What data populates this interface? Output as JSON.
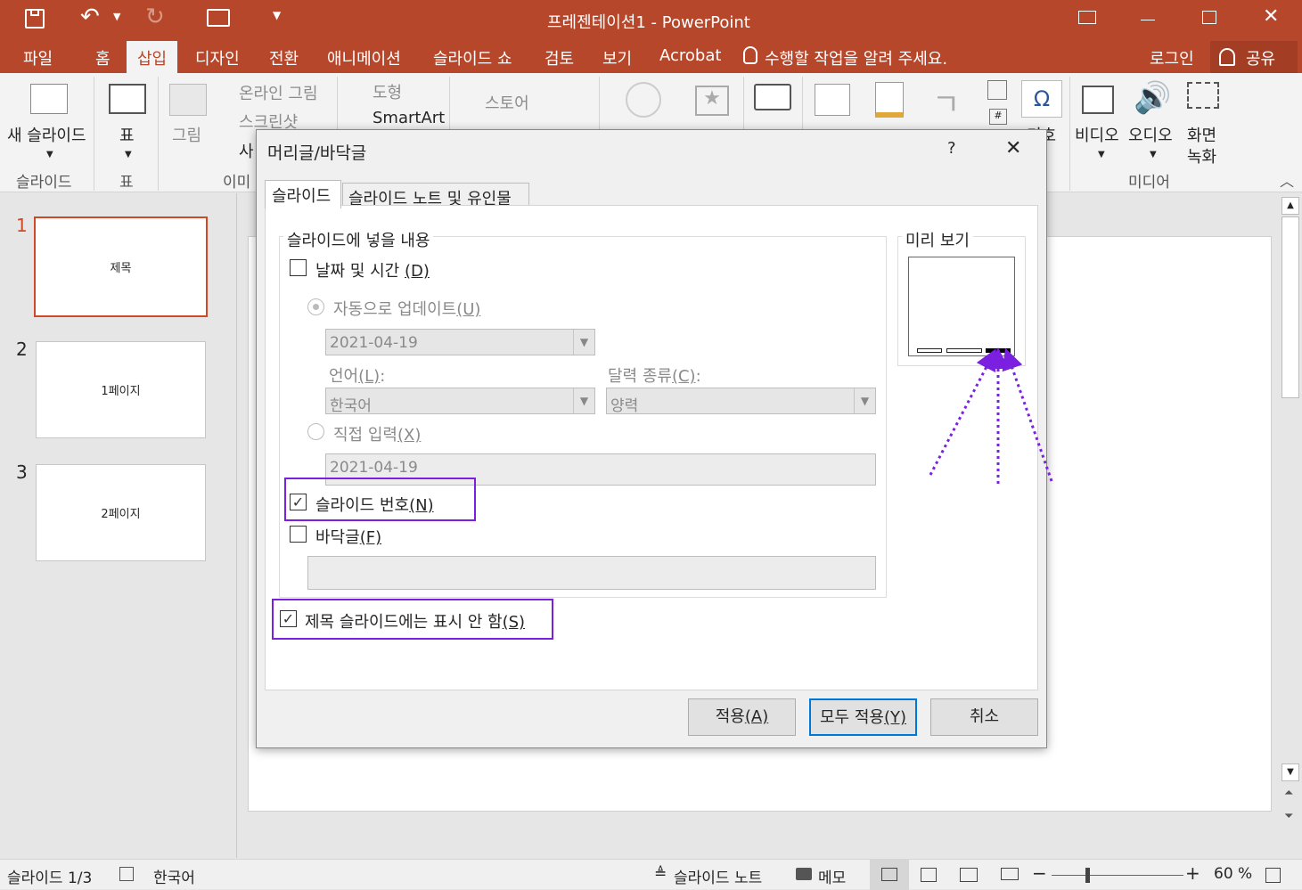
{
  "window": {
    "title": "프레젠테이션1 - PowerPoint"
  },
  "menu": {
    "tabs": [
      "파일",
      "홈",
      "삽입",
      "디자인",
      "전환",
      "애니메이션",
      "슬라이드 쇼",
      "검토",
      "보기",
      "Acrobat"
    ],
    "active_tab": "삽입",
    "tell_me": "수행할 작업을 알려 주세요.",
    "login": "로그인",
    "share": "공유"
  },
  "ribbon": {
    "new_slide": "새 슬라이드",
    "table": "표",
    "picture": "그림",
    "online_picture": "온라인 그림",
    "screenshot": "스크린샷",
    "photo_album_partial": "사",
    "shapes": "도형",
    "smartart": "SmartArt",
    "store": "스토어",
    "symbol_partial": "기호",
    "video": "비디오",
    "audio": "오디오",
    "screen_record_1": "화면",
    "screen_record_2": "녹화",
    "groups": {
      "slides": "슬라이드",
      "tables": "표",
      "images_partial": "이미",
      "media": "미디어"
    }
  },
  "slides": [
    {
      "num": "1",
      "text": "제목"
    },
    {
      "num": "2",
      "text": "1페이지"
    },
    {
      "num": "3",
      "text": "2페이지"
    }
  ],
  "dialog": {
    "title": "머리글/바닥글",
    "help": "?",
    "tabs": [
      "슬라이드",
      "슬라이드 노트 및 유인물"
    ],
    "group_label": "슬라이드에 넣을 내용",
    "date_time": {
      "label": "날짜 및 시간",
      "key": "(D)",
      "checked": false
    },
    "auto_update": {
      "label": "자동으로 업데이트",
      "key": "(U)"
    },
    "auto_date_value": "2021-04-19",
    "language": {
      "label": "언어",
      "key": "(L)",
      "suffix": ":",
      "value": "한국어"
    },
    "calendar": {
      "label": "달력 종류",
      "key": "(C)",
      "suffix": ":",
      "value": "양력"
    },
    "fixed": {
      "label": "직접 입력",
      "key": "(X)"
    },
    "fixed_value": "2021-04-19",
    "slide_number": {
      "label": "슬라이드 번호",
      "key": "(N)",
      "checked": true
    },
    "footer": {
      "label": "바닥글",
      "key": "(F)",
      "checked": false
    },
    "footer_value": "",
    "dont_show_title": {
      "label": "제목 슬라이드에는 표시 안 함",
      "key": "(S)",
      "checked": true
    },
    "preview_label": "미리 보기",
    "buttons": {
      "apply": "적용",
      "apply_key": "(A)",
      "apply_all": "모두 적용",
      "apply_all_key": "(Y)",
      "cancel": "취소"
    }
  },
  "status": {
    "slide_info": "슬라이드 1/3",
    "language": "한국어",
    "notes": "슬라이드 노트",
    "comments": "메모",
    "zoom": "60 %"
  },
  "colors": {
    "accent": "#b7472a",
    "highlight": "#7b1fe0"
  }
}
